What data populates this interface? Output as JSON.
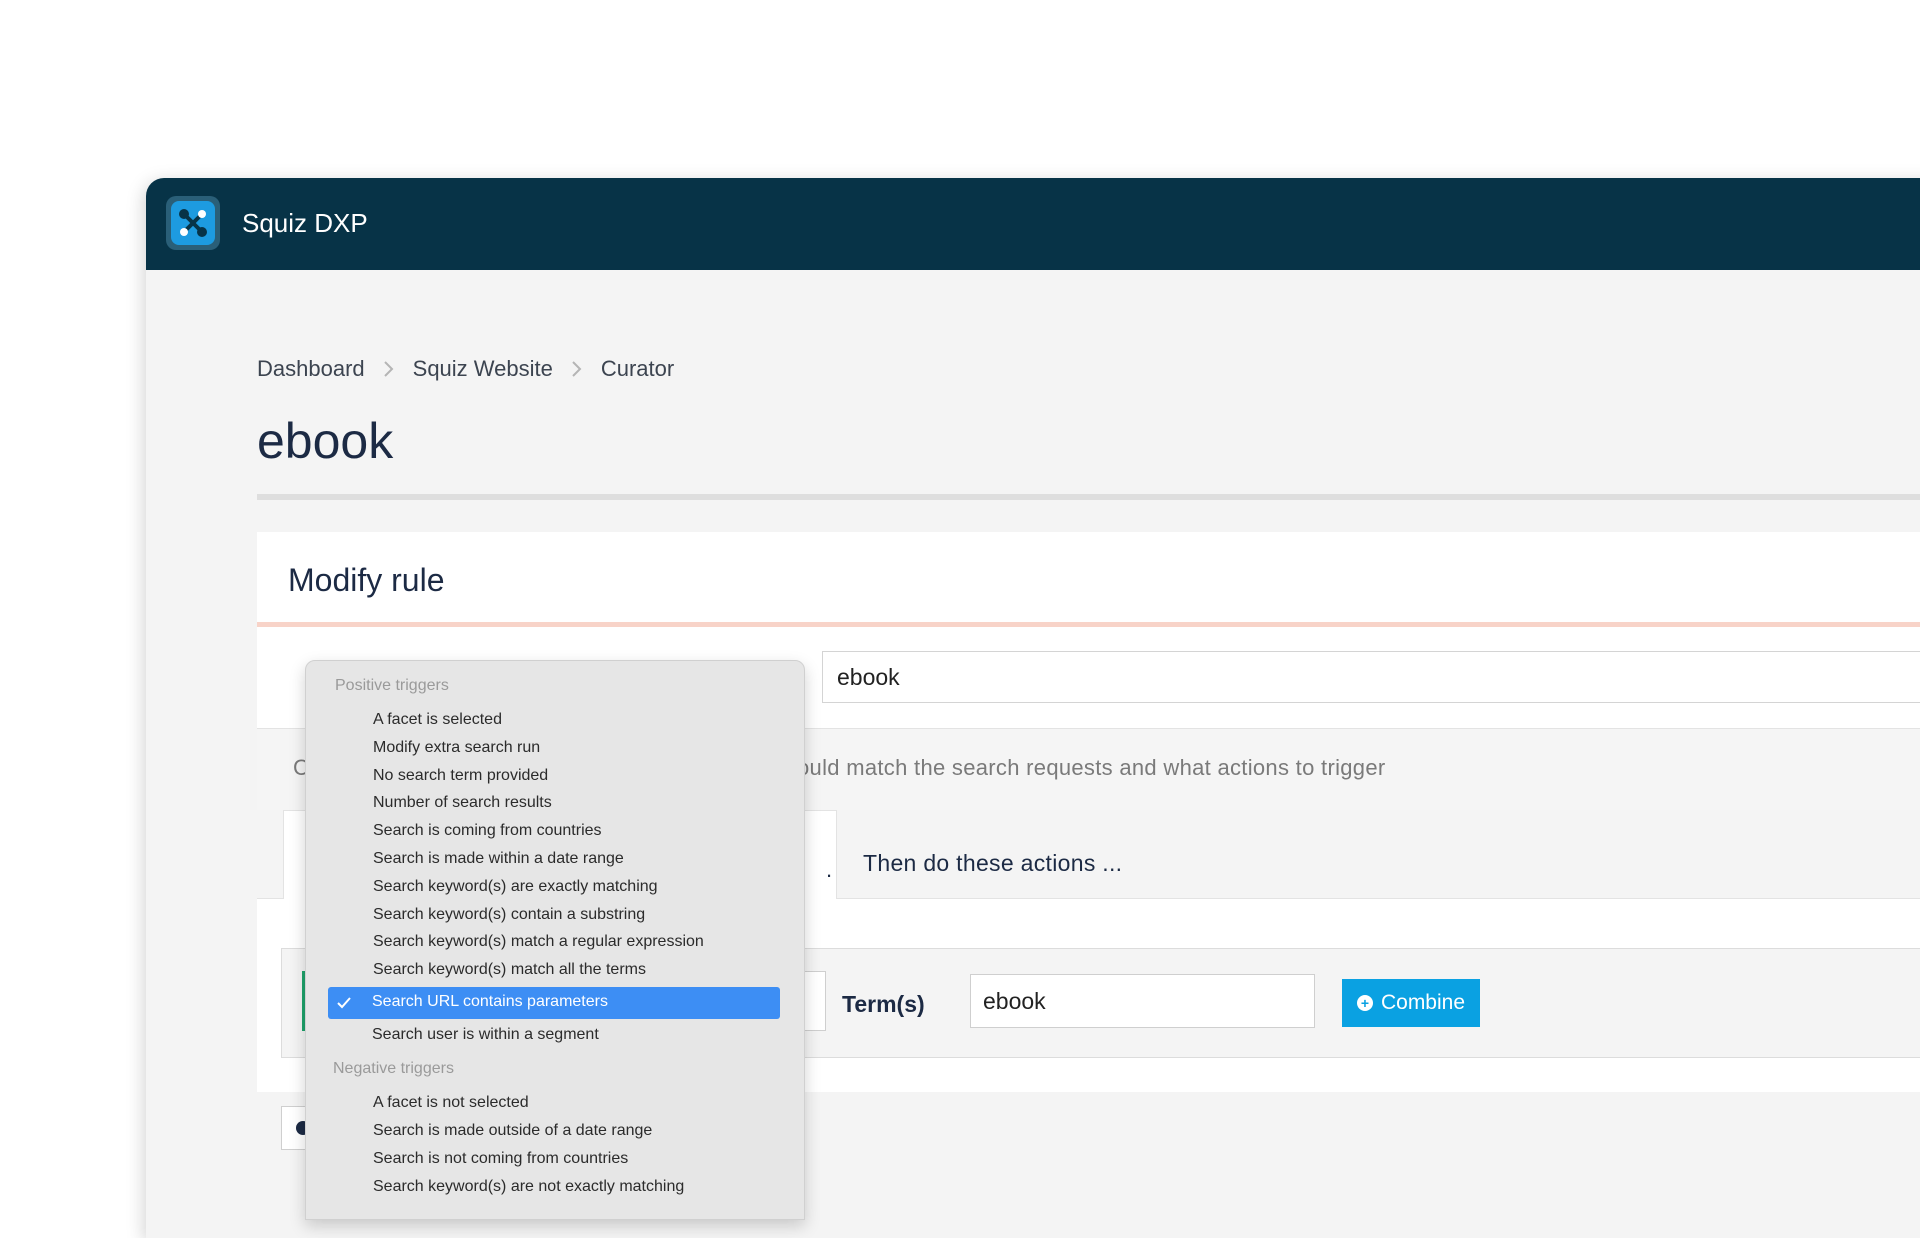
{
  "app": {
    "title": "Squiz DXP",
    "logo_icon": "squiz-logo-icon",
    "colors": {
      "appbar": "#073347",
      "accent": "#0aa1e2",
      "selected": "#3d8ef4",
      "success": "#1ea36b"
    }
  },
  "breadcrumb": [
    "Dashboard",
    "Squiz Website",
    "Curator"
  ],
  "page": {
    "title": "ebook"
  },
  "card": {
    "title": "Modify rule",
    "name_value": "ebook",
    "description_visible": "C",
    "description_tail": "ould match the search requests and what actions to trigger",
    "tab_partial": ".",
    "tab_actions": "Then do these actions ..."
  },
  "rule": {
    "term_label": "Term(s)",
    "term_value": "ebook",
    "combine_label": "Combine"
  },
  "dropdown": {
    "positive_label": "Positive triggers",
    "positive_items": [
      "A facet is selected",
      "Modify extra search run",
      "No search term provided",
      "Number of search results",
      "Search is coming from countries",
      "Search is made within a date range",
      "Search keyword(s) are exactly matching",
      "Search keyword(s) contain a substring",
      "Search keyword(s) match a regular expression",
      "Search keyword(s) match all the terms"
    ],
    "selected_item": "Search URL contains parameters",
    "after_selected": "Search user is within a segment",
    "negative_label": "Negative triggers",
    "negative_items": [
      "A facet is not selected",
      "Search is made outside of a date range",
      "Search is not coming from countries",
      "Search keyword(s) are not exactly matching"
    ]
  }
}
